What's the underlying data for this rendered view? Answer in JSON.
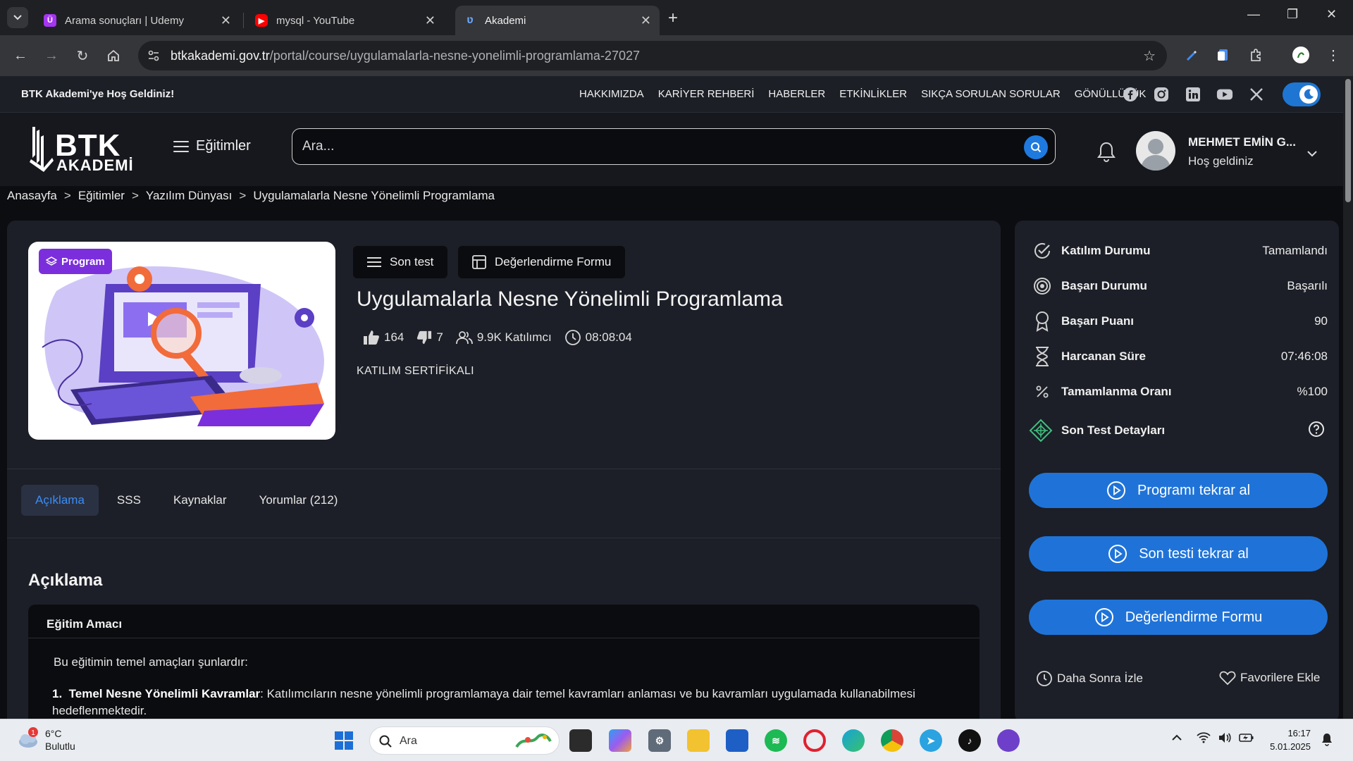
{
  "browser": {
    "tabs": [
      {
        "title": "Arama sonuçları | Udemy",
        "icon": "udemy-icon",
        "active": false
      },
      {
        "title": "mysql - YouTube",
        "icon": "youtube-icon",
        "active": false
      },
      {
        "title": "Akademi",
        "icon": "btk-icon",
        "active": true
      }
    ],
    "url_host": "btkakademi.gov.tr",
    "url_path": "/portal/course/uygulamalarla-nesne-yonelimli-programlama-27027"
  },
  "site": {
    "welcome": "BTK Akademi'ye Hoş Geldiniz!",
    "topnav": [
      "HAKKIMIZDA",
      "KARİYER REHBERİ",
      "HABERLER",
      "ETKİNLİKLER",
      "SIKÇA SORULAN SORULAR",
      "GÖNÜLLÜLÜK"
    ],
    "logo_top": "BTK",
    "logo_bottom": "AKADEMİ",
    "menu_label": "Eğitimler",
    "search_placeholder": "Ara...",
    "user_name": "MEHMET EMİN G...",
    "user_greeting": "Hoş geldiniz"
  },
  "breadcrumb": [
    "Anasayfa",
    "Eğitimler",
    "Yazılım Dünyası",
    "Uygulamalarla Nesne Yönelimli Programlama"
  ],
  "breadcrumb_sep": ">",
  "course": {
    "badge": "Program",
    "btn_final_test": "Son test",
    "btn_evaluation": "Değerlendirme Formu",
    "title": "Uygulamalarla Nesne Yönelimli Programlama",
    "likes": "164",
    "dislikes": "7",
    "participants": "9.9K Katılımcı",
    "duration": "08:08:04",
    "certificate": "KATILIM SERTİFİKALI"
  },
  "tabs": [
    "Açıklama",
    "SSS",
    "Kaynaklar",
    "Yorumlar (212)"
  ],
  "description": {
    "heading": "Açıklama",
    "panel_title": "Eğitim Amacı",
    "intro": "Bu eğitimin temel amaçları şunlardır:",
    "item1_number": "1.",
    "item1_bold": "Temel Nesne Yönelimli Kavramlar",
    "item1_text": ": Katılımcıların nesne yönelimli programlamaya dair temel kavramları anlaması ve bu kavramları uygulamada kullanabilmesi hedeflenmektedir."
  },
  "status": {
    "rows": [
      {
        "label": "Katılım Durumu",
        "value": "Tamamlandı",
        "icon": "check-circle-icon"
      },
      {
        "label": "Başarı Durumu",
        "value": "Başarılı",
        "icon": "target-icon"
      },
      {
        "label": "Başarı Puanı",
        "value": "90",
        "icon": "award-icon"
      },
      {
        "label": "Harcanan Süre",
        "value": "07:46:08",
        "icon": "hourglass-icon"
      },
      {
        "label": "Tamamlanma Oranı",
        "value": "%100",
        "icon": "percent-icon"
      }
    ],
    "test_details": "Son Test Detayları",
    "btn_retake_program": "Programı tekrar al",
    "btn_retake_test": "Son testi tekrar al",
    "btn_evaluation": "Değerlendirme Formu",
    "watch_later": "Daha Sonra İzle",
    "add_favorite": "Favorilere Ekle"
  },
  "taskbar": {
    "weather_temp": "6°C",
    "weather_cond": "Bulutlu",
    "weather_badge": "1",
    "search_label": "Ara",
    "time": "16:17",
    "date": "5.01.2025"
  },
  "colors": {
    "accent": "#1f73d8",
    "tab_active": "#3a8df5",
    "badge_purple": "#7b2fdc"
  }
}
